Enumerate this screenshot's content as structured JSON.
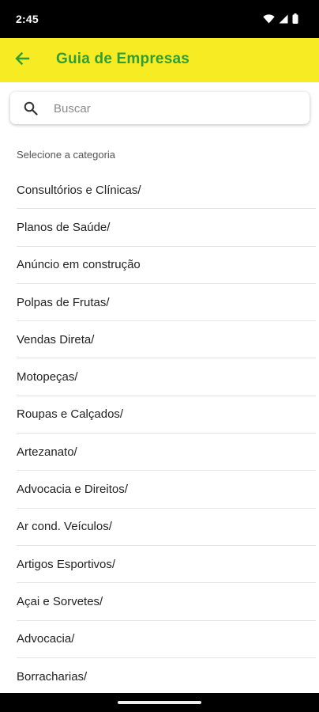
{
  "status_bar": {
    "time": "2:45",
    "icons": [
      "wifi-icon",
      "signal-icon",
      "battery-icon"
    ]
  },
  "app_bar": {
    "title": "Guia de Empresas",
    "back_icon": "arrow-left-icon",
    "background_color": "#f7ec24",
    "title_color": "#2e9e3a"
  },
  "search": {
    "placeholder": "Buscar",
    "value": "",
    "icon": "search-icon"
  },
  "categories": {
    "section_label": "Selecione a categoria",
    "items": [
      {
        "label": "Consultórios e Clínicas/"
      },
      {
        "label": "Planos de Saúde/"
      },
      {
        "label": "Anúncio em construção"
      },
      {
        "label": "Polpas de Frutas/"
      },
      {
        "label": "Vendas Direta/"
      },
      {
        "label": "Motopeças/"
      },
      {
        "label": "Roupas e Calçados/"
      },
      {
        "label": "Artezanato/"
      },
      {
        "label": "Advocacia e Direitos/"
      },
      {
        "label": "Ar cond. Veículos/"
      },
      {
        "label": "Artigos Esportivos/"
      },
      {
        "label": "Açai e Sorvetes/"
      },
      {
        "label": "Advocacia/"
      },
      {
        "label": "Borracharias/"
      }
    ]
  }
}
